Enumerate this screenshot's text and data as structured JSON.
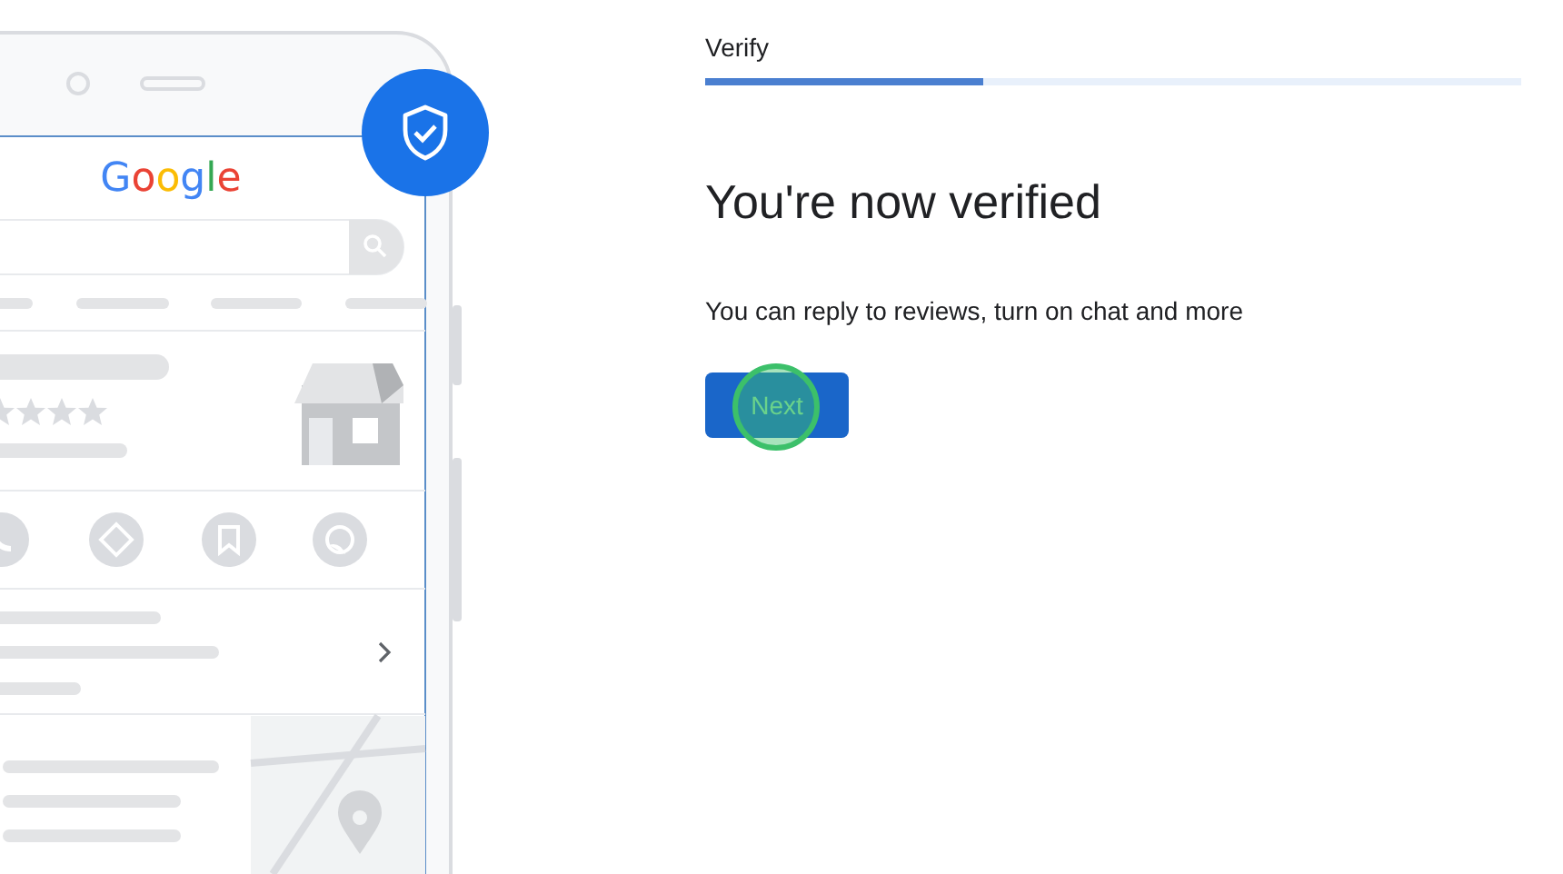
{
  "illustration": {
    "logo": "Google"
  },
  "step": {
    "label": "Verify",
    "level": 0.34
  },
  "heading": "You're now verified",
  "description": "You can reply to reviews, turn on chat and more",
  "next_button": {
    "label": "Next",
    "clicked": true
  }
}
